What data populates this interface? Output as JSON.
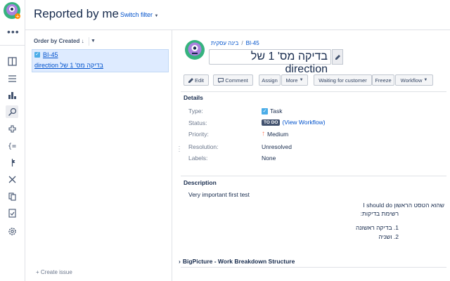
{
  "header": {
    "title": "Reported by me",
    "switch_filter": "Switch filter"
  },
  "rail": {
    "icons": [
      "plus-avatar-icon",
      "more-icon",
      "board-icon",
      "backlog-icon",
      "reports-icon",
      "issues-icon",
      "components-icon",
      "code-icon",
      "releases-icon",
      "shortcut-icon",
      "pages-icon",
      "tests-icon",
      "settings-icon"
    ]
  },
  "list": {
    "order_by": "Order by Created",
    "issues": [
      {
        "key": "BI-45",
        "summary": "בדיקה מס' 1 של direction"
      }
    ],
    "create_issue": "+ Create issue"
  },
  "issue": {
    "project": "בינה עסקית",
    "key": "BI-45",
    "summary": "בדיקה מס' 1 של direction",
    "buttons": {
      "edit": "Edit",
      "comment": "Comment",
      "assign": "Assign",
      "more": "More",
      "waiting": "Waiting for customer",
      "freeze": "Freeze",
      "workflow": "Workflow"
    },
    "details": {
      "title": "Details",
      "type_label": "Type:",
      "type_value": "Task",
      "status_label": "Status:",
      "status_value": "TO DO",
      "view_workflow": "(View Workflow)",
      "priority_label": "Priority:",
      "priority_value": "Medium",
      "resolution_label": "Resolution:",
      "resolution_value": "Unresolved",
      "labels_label": "Labels:",
      "labels_value": "None"
    },
    "description": {
      "title": "Description",
      "line1": "Very important first test",
      "line2": "שהוא הטסט הראשון I should do",
      "line3": "רשימת בדיקות:",
      "list": [
        "1. בדיקה ראשונה",
        "2. ושניה"
      ]
    },
    "bigpicture": "BigPicture - Work Breakdown Structure"
  },
  "colors": {
    "link": "#0052cc",
    "todo": "#42526e",
    "task": "#4bade8",
    "priority": "#ff7452"
  }
}
